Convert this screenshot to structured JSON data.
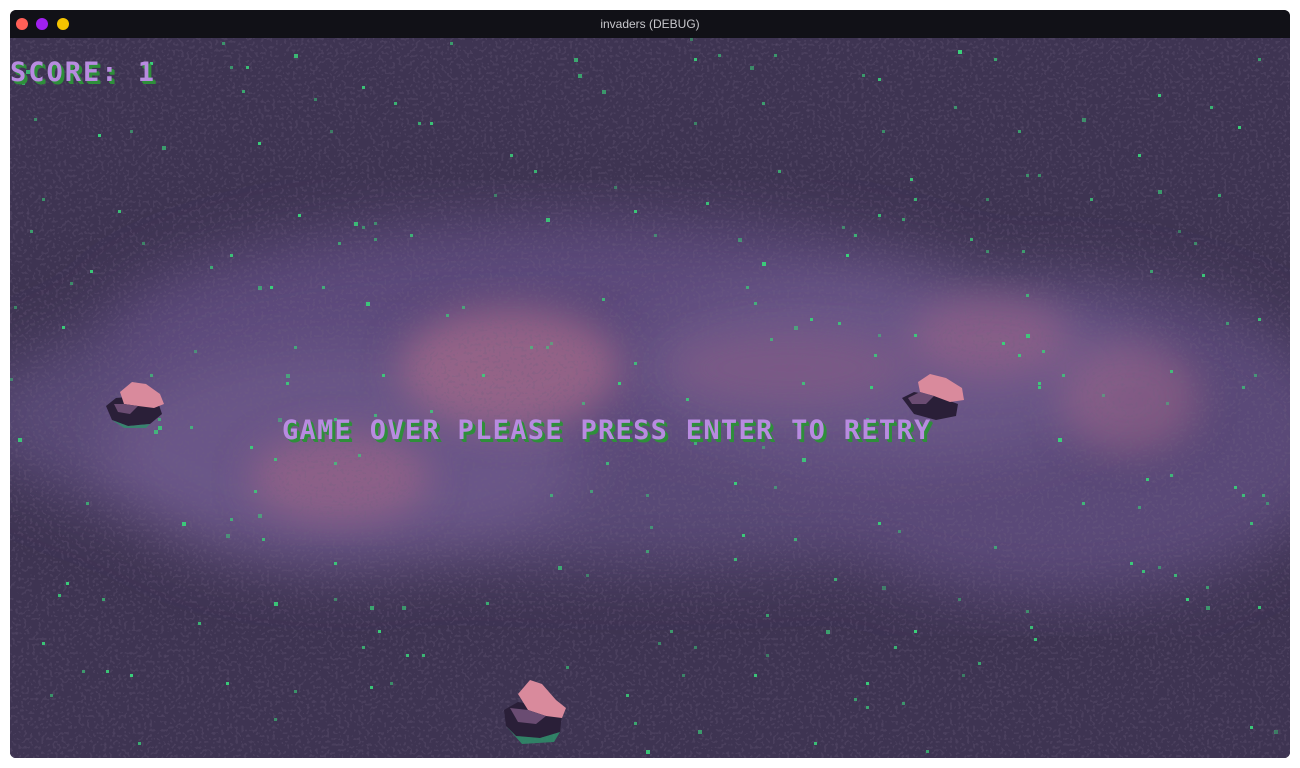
{
  "window": {
    "title": "invaders (DEBUG)",
    "buttons": [
      {
        "name": "close",
        "color": "#ff5f57"
      },
      {
        "name": "minimize",
        "color": "#a020f0"
      },
      {
        "name": "zoom",
        "color": "#f5c400"
      }
    ]
  },
  "hud": {
    "score_text": "SCORE: 1",
    "message": "GAME OVER PLEASE PRESS ENTER TO RETRY"
  },
  "colors": {
    "text_fill": "#b88be0",
    "text_shadow": "#2e8f3a",
    "space_dark": "#3e3452",
    "nebula_mid": "#5c4a78",
    "nebula_light": "#6e5a8c",
    "nebula_pink": "#a86a8a",
    "star": "#3ad07a",
    "asteroid_pink": "#d98a9c",
    "asteroid_dark": "#2a1f38"
  },
  "asteroids": [
    {
      "name": "asteroid-left"
    },
    {
      "name": "asteroid-right"
    },
    {
      "name": "asteroid-bottom"
    }
  ]
}
